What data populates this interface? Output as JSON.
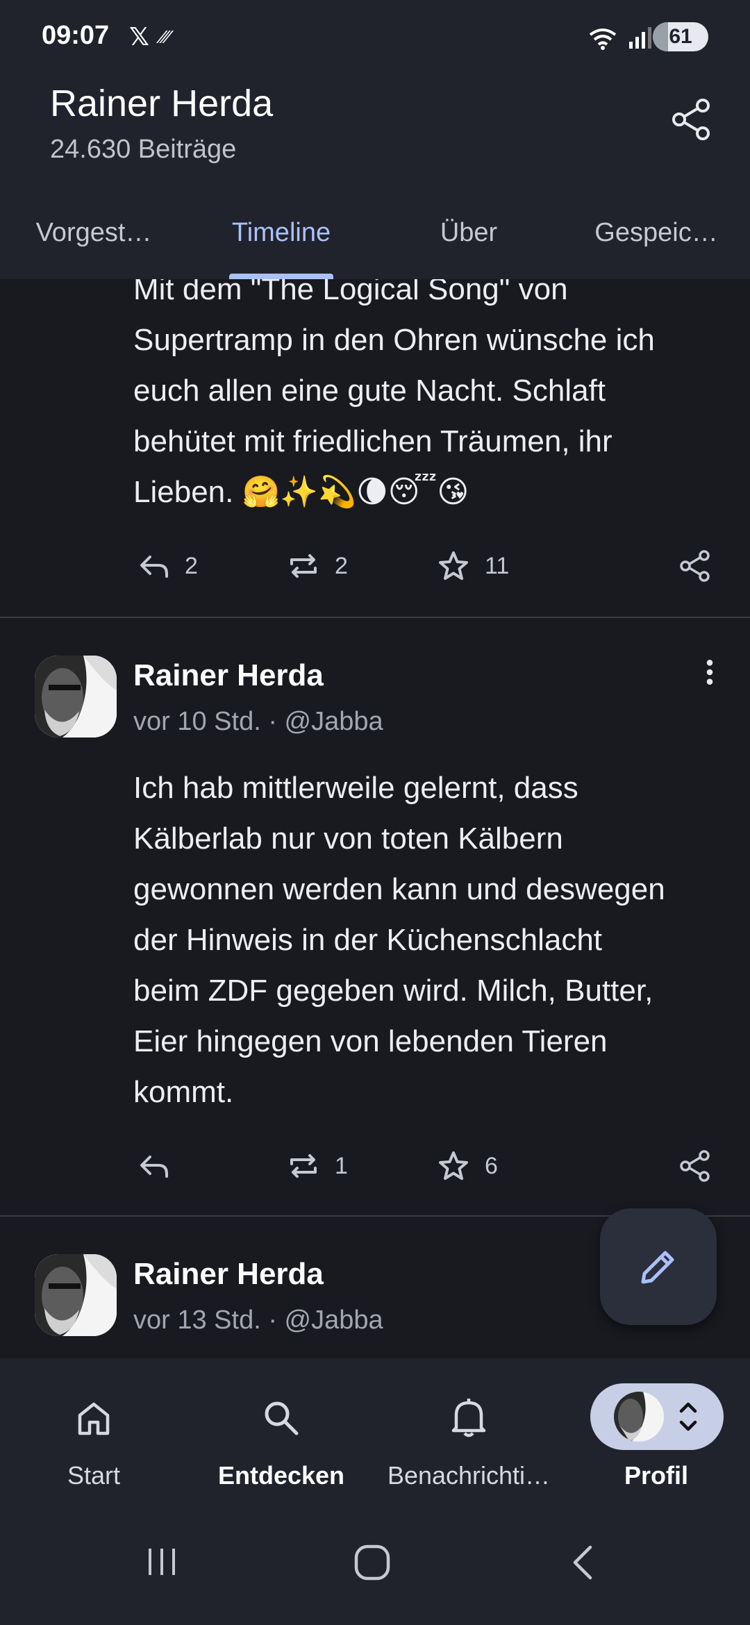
{
  "status_bar": {
    "time": "09:07",
    "x_glyph": "𝕏",
    "extra_glyph": "⁄⁄⁄",
    "battery": "61"
  },
  "header": {
    "name": "Rainer Herda",
    "posts_count": "24.630 Beiträge"
  },
  "tabs": [
    {
      "label": "Vorgest…"
    },
    {
      "label": "Timeline"
    },
    {
      "label": "Über"
    },
    {
      "label": "Gespeic…"
    }
  ],
  "posts": [
    {
      "text_lines": [
        "Mit dem \"The Logical Song\" von",
        "Supertramp in den Ohren wünsche ich",
        "euch allen eine gute Nacht. Schlaft",
        "behütet mit friedlichen Träumen, ihr",
        "Lieben. 🤗✨💫🌘😴😘"
      ],
      "replies": "2",
      "boosts": "2",
      "favourites": "11"
    },
    {
      "author": "Rainer Herda",
      "meta": "vor 10 Std. · @Jabba",
      "text_lines": [
        "Ich hab mittlerweile gelernt, dass",
        "Kälberlab nur von toten Kälbern",
        "gewonnen werden kann und deswegen",
        "der Hinweis in der Küchenschlacht",
        "beim ZDF gegeben wird. Milch, Butter,",
        "Eier hingegen von lebenden Tieren",
        "kommt."
      ],
      "replies": "",
      "boosts": "1",
      "favourites": "6"
    },
    {
      "author": "Rainer Herda",
      "meta": "vor 13 Std. · @Jabba"
    }
  ],
  "bottom_nav": [
    {
      "label": "Start",
      "icon": "home-icon"
    },
    {
      "label": "Entdecken",
      "icon": "search-icon"
    },
    {
      "label": "Benachrichti…",
      "icon": "bell-icon"
    },
    {
      "label": "Profil",
      "icon": "avatar"
    }
  ],
  "colors": {
    "background": "#181a20",
    "surface": "#20232b",
    "accent": "#a9c1ff",
    "divider": "#3a3d46"
  }
}
